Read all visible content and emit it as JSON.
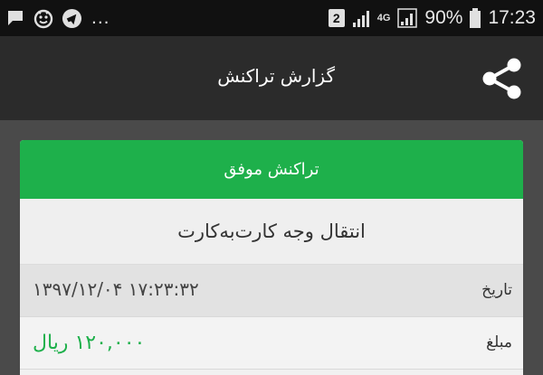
{
  "status_bar": {
    "icons_left": [
      "chat-icon",
      "emoji-icon",
      "telegram-icon"
    ],
    "overflow": "...",
    "sim_indicator": "2",
    "network": "4G",
    "battery": "90%",
    "time": "17:23"
  },
  "app_bar": {
    "title": "گزارش تراکنش",
    "share_icon": "share-icon"
  },
  "receipt": {
    "status": "تراکنش موفق",
    "status_color": "#1eb04b",
    "transaction_type": "انتقال وجه کارت‌به‌کارت",
    "date_label": "تاریخ",
    "date_value": "۱۳۹۷/۱۲/۰۴ ۱۷:۲۳:۳۲",
    "amount_label": "مبلغ",
    "amount_value": "۱۲۰,۰۰۰ ریال"
  }
}
